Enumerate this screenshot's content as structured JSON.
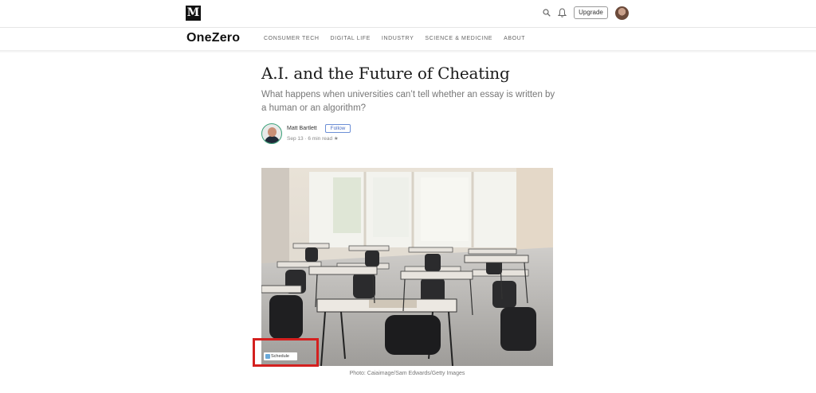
{
  "topbar": {
    "logo_letter": "M",
    "upgrade_label": "Upgrade",
    "icons": [
      "search-icon",
      "bell-icon"
    ]
  },
  "publication": {
    "name": "OneZero",
    "nav": [
      "CONSUMER TECH",
      "DIGITAL LIFE",
      "INDUSTRY",
      "SCIENCE & MEDICINE",
      "ABOUT"
    ]
  },
  "article": {
    "title": "A.I. and the Future of Cheating",
    "subtitle": "What happens when universities can’t tell whether an essay is written by a human or an algorithm?",
    "author": "Matt Bartlett",
    "follow_label": "Follow",
    "meta": "Sep 13 · 6 min read ★"
  },
  "hero": {
    "schedule_label": "Schedule",
    "caption": "Photo: Caiaimage/Sam Edwards/Getty Images",
    "highlight_color": "#d4201f"
  }
}
